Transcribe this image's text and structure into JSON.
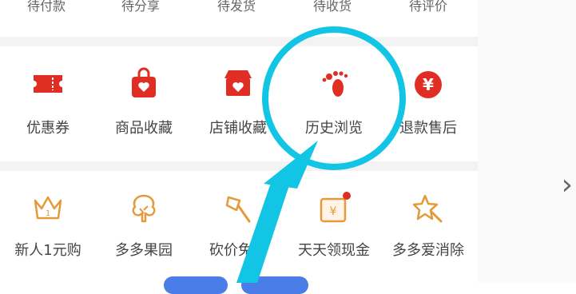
{
  "top_row": [
    "待付款",
    "待分享",
    "待发货",
    "待收货",
    "待评价"
  ],
  "tools_row": [
    {
      "label": "优惠券",
      "icon": "coupon-icon"
    },
    {
      "label": "商品收藏",
      "icon": "favorite-bag-icon"
    },
    {
      "label": "店铺收藏",
      "icon": "shop-favorite-icon"
    },
    {
      "label": "历史浏览",
      "icon": "footprint-icon"
    },
    {
      "label": "退款售后",
      "icon": "refund-yen-icon"
    }
  ],
  "activities_row": [
    {
      "label": "新人1元购",
      "icon": "crown-icon"
    },
    {
      "label": "多多果园",
      "icon": "tree-icon"
    },
    {
      "label": "砍价免费",
      "icon": "axe-icon"
    },
    {
      "label": "天天领现金",
      "icon": "cash-envelope-icon"
    },
    {
      "label": "多多爱消除",
      "icon": "star-wand-icon"
    }
  ],
  "colors": {
    "accent_red": "#e02e24",
    "activity_orange": "#e59a3a",
    "highlight_cyan": "#13c5e4",
    "text": "#444444"
  },
  "right_arrow": "›"
}
